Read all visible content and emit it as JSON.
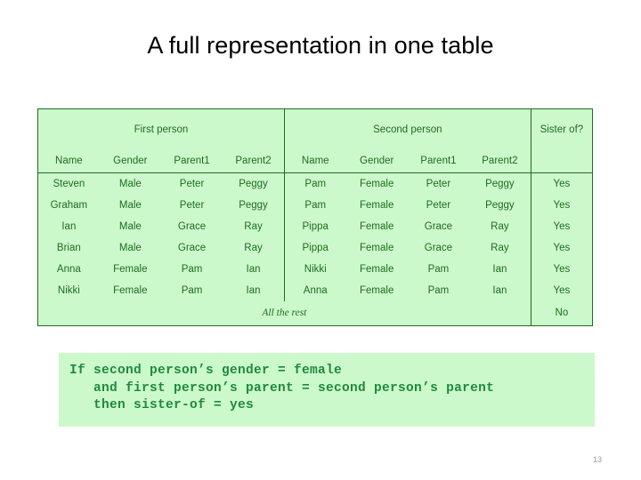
{
  "slide": {
    "title": "A full representation in one table",
    "number": "13"
  },
  "table": {
    "group_headers": [
      {
        "label": "First person",
        "span": 4
      },
      {
        "label": "Second person",
        "span": 4
      },
      {
        "label": "Sister of?",
        "span": 1
      }
    ],
    "sub_headers": [
      "Name",
      "Gender",
      "Parent1",
      "Parent2",
      "Name",
      "Gender",
      "Parent1",
      "Parent2",
      ""
    ],
    "rows": [
      [
        "Steven",
        "Male",
        "Peter",
        "Peggy",
        "Pam",
        "Female",
        "Peter",
        "Peggy",
        "Yes"
      ],
      [
        "Graham",
        "Male",
        "Peter",
        "Peggy",
        "Pam",
        "Female",
        "Peter",
        "Peggy",
        "Yes"
      ],
      [
        "Ian",
        "Male",
        "Grace",
        "Ray",
        "Pippa",
        "Female",
        "Grace",
        "Ray",
        "Yes"
      ],
      [
        "Brian",
        "Male",
        "Grace",
        "Ray",
        "Pippa",
        "Female",
        "Grace",
        "Ray",
        "Yes"
      ],
      [
        "Anna",
        "Female",
        "Pam",
        "Ian",
        "Nikki",
        "Female",
        "Pam",
        "Ian",
        "Yes"
      ],
      [
        "Nikki",
        "Female",
        "Pam",
        "Ian",
        "Anna",
        "Female",
        "Pam",
        "Ian",
        "Yes"
      ]
    ],
    "rest_row": {
      "label": "All the rest",
      "answer": "No"
    }
  },
  "rule_block": {
    "lines": [
      "If second person’s gender = female",
      "   and first person’s parent = second person’s parent",
      "   then sister-of = yes"
    ]
  },
  "colors": {
    "table_fill": "#ccf9cc",
    "table_border": "#1f6b21",
    "table_text": "#1f6b21",
    "code_text": "#1f8a3b",
    "title_text": "#000000",
    "slide_number_text": "#9a9a9a"
  }
}
